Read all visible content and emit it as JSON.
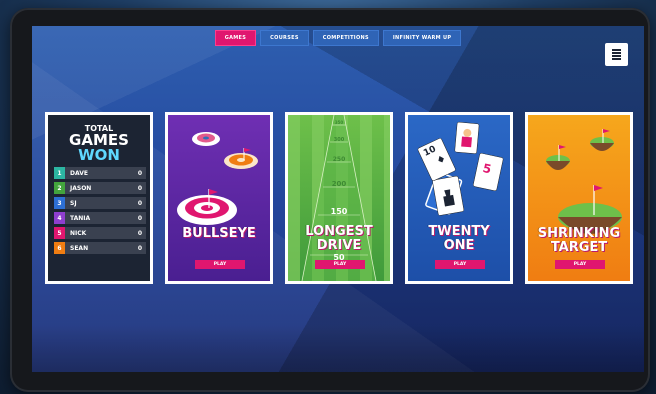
{
  "nav": {
    "tabs": [
      "Games",
      "Courses",
      "Competitions",
      "Infinity Warm Up"
    ],
    "active_index": 0
  },
  "scoreboard": {
    "line1": "TOTAL",
    "line2": "GAMES",
    "line3": "WON",
    "players": [
      {
        "rank": "1",
        "name": "Dave",
        "score": "0",
        "color": "#2cb6a2"
      },
      {
        "rank": "2",
        "name": "Jason",
        "score": "0",
        "color": "#43a43d"
      },
      {
        "rank": "3",
        "name": "SJ",
        "score": "0",
        "color": "#2d6fd3"
      },
      {
        "rank": "4",
        "name": "Tania",
        "score": "0",
        "color": "#8f3fcf"
      },
      {
        "rank": "5",
        "name": "Nick",
        "score": "0",
        "color": "#e0166f"
      },
      {
        "rank": "6",
        "name": "Sean",
        "score": "0",
        "color": "#f07d12"
      }
    ]
  },
  "games": [
    {
      "title_line1": "Bullseye",
      "title_line2": "",
      "button": "Play"
    },
    {
      "title_line1": "Longest",
      "title_line2": "Drive",
      "button": "Play"
    },
    {
      "title_line1": "Twenty",
      "title_line2": "One",
      "button": "Play"
    },
    {
      "title_line1": "Shrinking",
      "title_line2": "Target",
      "button": "Play"
    }
  ],
  "drive_distances": [
    "350",
    "300",
    "250",
    "200",
    "150",
    "50"
  ],
  "card_values": [
    "10",
    "5"
  ],
  "colors": {
    "accent": "#e0166f",
    "won": "#5fd8ff"
  }
}
